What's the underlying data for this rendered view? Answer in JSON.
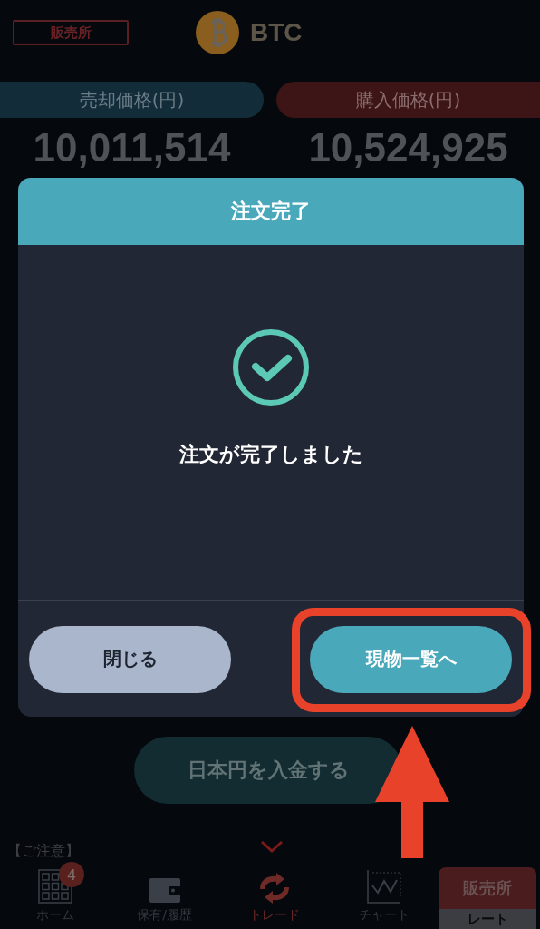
{
  "header": {
    "market_tag": "販売所",
    "coin": "BTC"
  },
  "prices": [
    {
      "label": "売却価格(円)",
      "value": "10,011,514",
      "kind": "sell"
    },
    {
      "label": "購入価格(円)",
      "value": "10,524,925",
      "kind": "buy"
    }
  ],
  "deposit_button": "日本円を入金する",
  "notice": "【ご注意】",
  "dialog": {
    "title": "注文完了",
    "message": "注文が完了しました",
    "buttons": [
      {
        "label": "閉じる",
        "kind": "secondary"
      },
      {
        "label": "現物一覧へ",
        "kind": "primary"
      }
    ]
  },
  "tab_bar": [
    {
      "label": "ホーム",
      "kind": "home",
      "badge": "4",
      "selected": false
    },
    {
      "label": "保有/履歴",
      "kind": "wallet",
      "selected": false
    },
    {
      "label": "トレード",
      "kind": "trade",
      "selected": true
    },
    {
      "label": "チャート",
      "kind": "chart",
      "selected": false
    }
  ],
  "mode_switch": [
    {
      "label": "販売所",
      "selected": true
    },
    {
      "label": "レート",
      "selected": false
    }
  ]
}
